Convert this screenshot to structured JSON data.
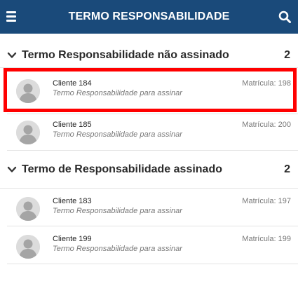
{
  "header": {
    "title": "TERMO RESPONSABILIDADE",
    "menu_icon": "hamburger-menu-icon",
    "search_icon": "search-icon",
    "background_color": "#1a4a7a"
  },
  "groups": [
    {
      "title": "Termo Responsabilidade não assinado",
      "count": "2",
      "icon": "chevron-down-icon",
      "items": [
        {
          "name": "Cliente 184",
          "status": "Termo Responsabilidade para assinar",
          "matricula": "Matrícula: 198",
          "highlighted": true
        },
        {
          "name": "Cliente 185",
          "status": "Termo Responsabilidade para assinar",
          "matricula": "Matrícula: 200",
          "highlighted": false
        }
      ]
    },
    {
      "title": "Termo de Responsabilidade assinado",
      "count": "2",
      "icon": "chevron-down-icon",
      "items": [
        {
          "name": "Cliente 183",
          "status": "Termo Responsabilidade para assinar",
          "matricula": "Matrícula: 197",
          "highlighted": false
        },
        {
          "name": "Cliente 199",
          "status": "Termo Responsabilidade para assinar",
          "matricula": "Matrícula: 199",
          "highlighted": false
        }
      ]
    }
  ],
  "colors": {
    "highlight": "#ff0000"
  }
}
